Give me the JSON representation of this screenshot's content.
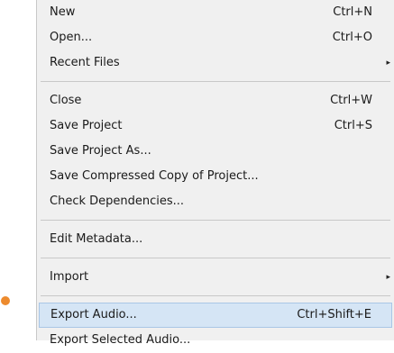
{
  "menu": {
    "group1": [
      {
        "label": "New",
        "shortcut": "Ctrl+N"
      },
      {
        "label": "Open...",
        "shortcut": "Ctrl+O"
      },
      {
        "label": "Recent Files",
        "shortcut": ""
      }
    ],
    "group2": [
      {
        "label": "Close",
        "shortcut": "Ctrl+W"
      },
      {
        "label": "Save Project",
        "shortcut": "Ctrl+S"
      },
      {
        "label": "Save Project As...",
        "shortcut": ""
      },
      {
        "label": "Save Compressed Copy of Project...",
        "shortcut": ""
      },
      {
        "label": "Check Dependencies...",
        "shortcut": ""
      }
    ],
    "group3": [
      {
        "label": "Edit Metadata...",
        "shortcut": ""
      }
    ],
    "group4": [
      {
        "label": "Import",
        "shortcut": ""
      }
    ],
    "group5": [
      {
        "label": "Export Audio...",
        "shortcut": "Ctrl+Shift+E"
      },
      {
        "label": "Export Selected Audio...",
        "shortcut": ""
      }
    ],
    "submenu_arrow": "▸",
    "highlight_color": "#d5e5f5",
    "pointer_dot_color": "#ed8b2e"
  }
}
